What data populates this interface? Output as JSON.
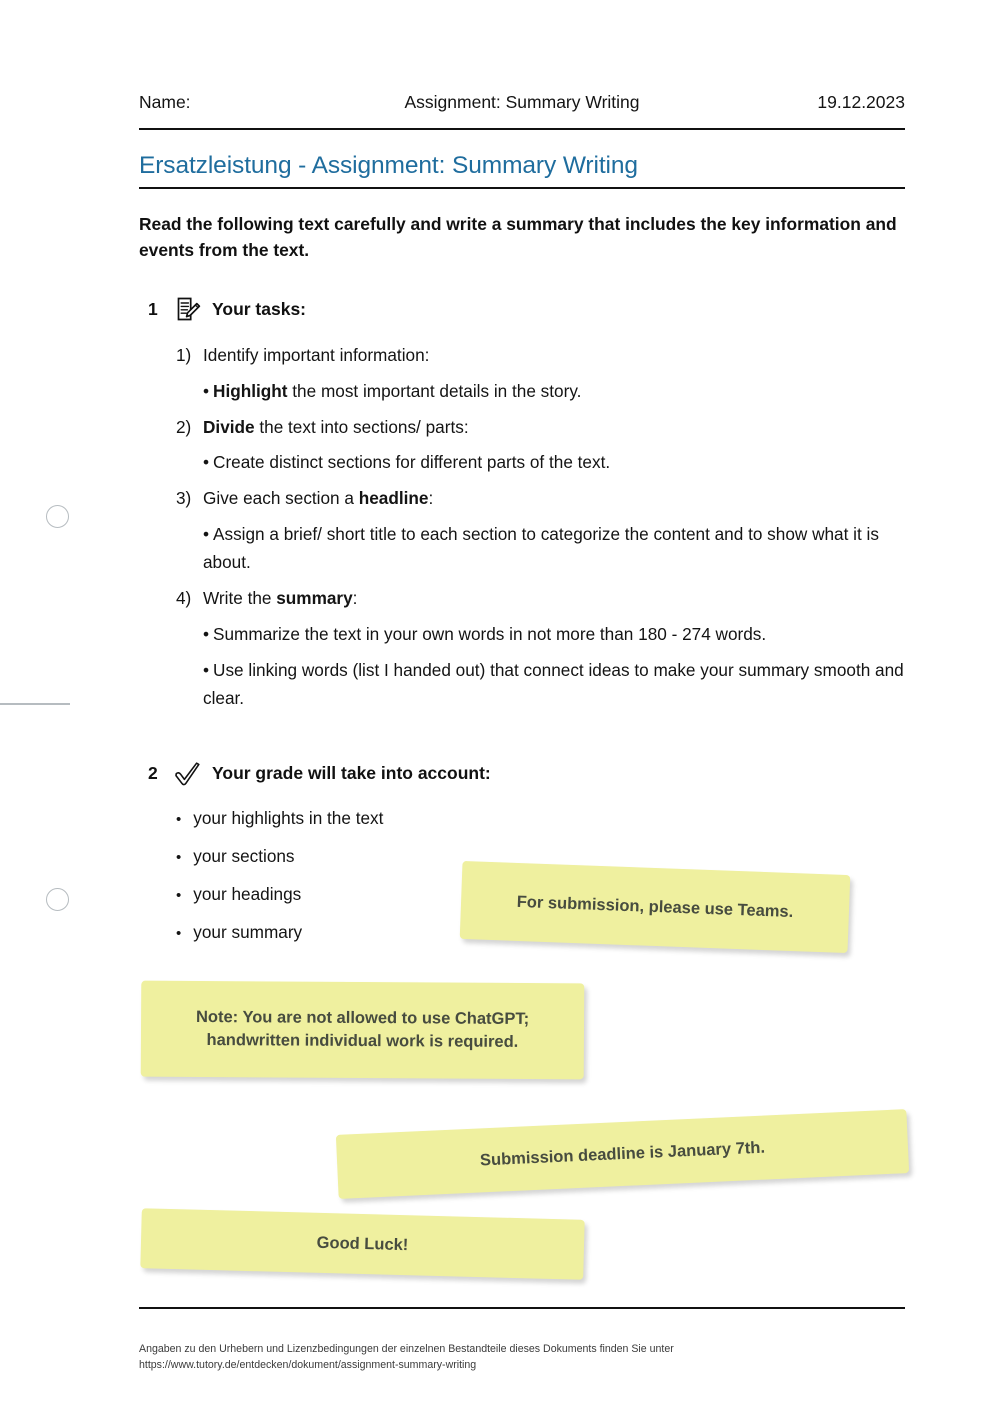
{
  "header": {
    "name_label": "Name:",
    "title": "Assignment: Summary Writing",
    "date": "19.12.2023"
  },
  "document": {
    "title": "Ersatzleistung - Assignment: Summary Writing",
    "title_color": "#1f6d9e",
    "intro": "Read the following text carefully and write a summary that includes the key information and events from the text."
  },
  "sections": [
    {
      "number": "1",
      "icon": "document-pencil-icon",
      "label": "Your tasks:",
      "tasks": [
        {
          "number": "1)",
          "text_plain": "Identify important information:",
          "text_pre": "",
          "bold": "",
          "text_post": "Identify important information:",
          "subs": [
            {
              "bullet": "•",
              "pre": "",
              "bold": "Highlight",
              "post": " the most important details in the story."
            }
          ]
        },
        {
          "number": "2)",
          "text_plain": "Divide the text into sections/ parts:",
          "text_pre": "",
          "bold": "Divide",
          "text_post": " the text into sections/ parts:",
          "subs": [
            {
              "bullet": "•",
              "pre": "Create distinct sections for different parts of the text.",
              "bold": "",
              "post": ""
            }
          ]
        },
        {
          "number": "3)",
          "text_plain": "Give each section a headline:",
          "text_pre": "Give each section a ",
          "bold": "headline",
          "text_post": ":",
          "subs": [
            {
              "bullet": "•",
              "pre": "Assign a brief/ short title to each section to categorize the content and to show what it is about.",
              "bold": "",
              "post": ""
            }
          ]
        },
        {
          "number": "4)",
          "text_plain": "Write the summary:",
          "text_pre": "Write the ",
          "bold": "summary",
          "text_post": ":",
          "subs": [
            {
              "bullet": "•",
              "pre": "Summarize the text in your own words in not more than 180 - 274 words.",
              "bold": "",
              "post": ""
            },
            {
              "bullet": "•",
              "pre": "Use linking words (list I handed out) that connect ideas to make your summary smooth and clear.",
              "bold": "",
              "post": ""
            }
          ]
        }
      ]
    },
    {
      "number": "2",
      "icon": "checkmark-icon",
      "label": "Your grade will take into account:",
      "items": [
        {
          "bullet": "•",
          "text": "your highlights in the text"
        },
        {
          "bullet": "•",
          "text": "your sections"
        },
        {
          "bullet": "•",
          "text": "your headings"
        },
        {
          "bullet": "•",
          "text": "your summary"
        }
      ]
    }
  ],
  "notes": [
    {
      "id": "teams",
      "text": "For submission, please use Teams.",
      "color": "#eff09f"
    },
    {
      "id": "chatgpt",
      "line1": "Note: You are not allowed to use ChatGPT;",
      "line2": "handwritten individual work is required.",
      "color": "#eff09f"
    },
    {
      "id": "deadline",
      "text": "Submission deadline is January 7th.",
      "color": "#eff09f"
    },
    {
      "id": "goodluck",
      "text": "Good Luck!",
      "color": "#eff09f"
    }
  ],
  "footer": {
    "line1": "Angaben zu den Urhebern und Lizenzbedingungen der einzelnen Bestandteile dieses Dokuments finden Sie unter",
    "line2": "https://www.tutory.de/entdecken/dokument/assignment-summary-writing"
  }
}
